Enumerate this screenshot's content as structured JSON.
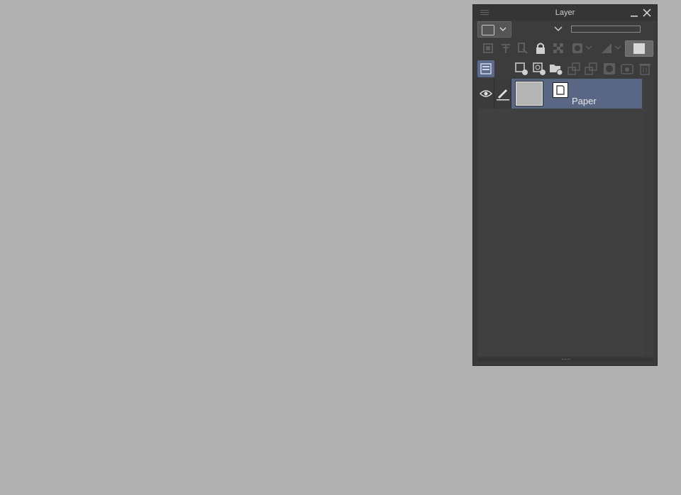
{
  "panel": {
    "title": "Layer"
  },
  "layers": [
    {
      "name": "Paper",
      "visible": true,
      "selected": true
    }
  ],
  "colors": {
    "canvas_bg": "#b0b0b0",
    "panel_bg": "#3a3a3a",
    "selection": "#5a6784"
  },
  "icons": {
    "toolbar_row2": [
      "clip-to-layer-below-icon",
      "reference-layer-icon",
      "draft-layer-icon",
      "lock-icon",
      "lock-transparency-icon",
      "mask-enable-icon",
      "ruler-display-icon",
      "layer-color-swatch-icon"
    ],
    "toolbar_row3": [
      "palette-color-icon",
      "new-raster-layer-icon",
      "new-vector-layer-icon",
      "new-folder-icon",
      "transfer-to-lower-layer-icon",
      "combine-with-lower-icon",
      "create-mask-icon",
      "apply-mask-icon",
      "delete-layer-icon"
    ]
  }
}
